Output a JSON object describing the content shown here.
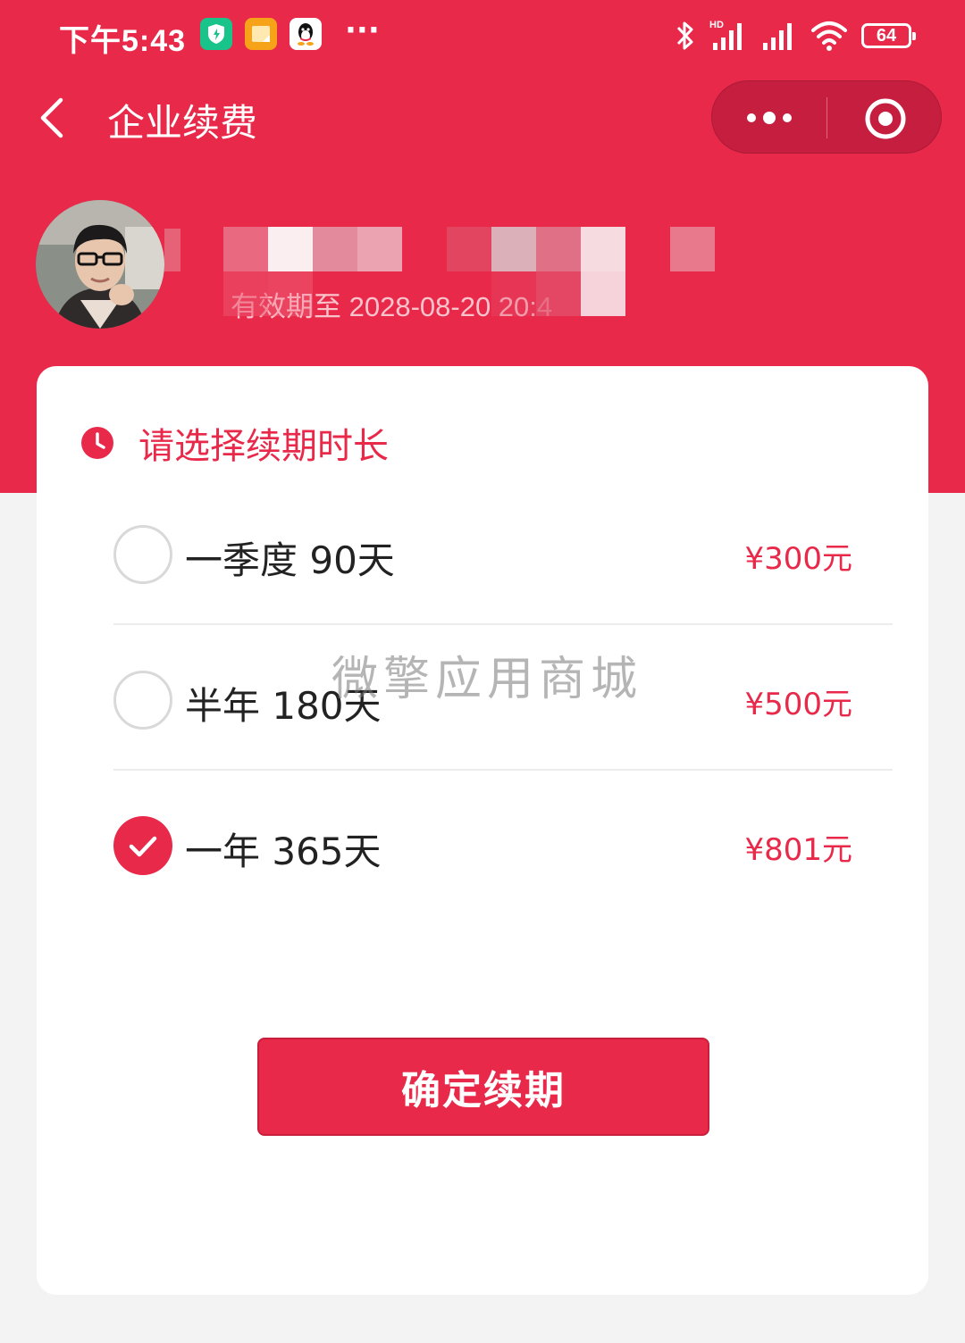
{
  "status_bar": {
    "time": "下午5:43",
    "more": "···",
    "battery": "64",
    "network_hd": "HD"
  },
  "header": {
    "title": "企业续费"
  },
  "profile": {
    "expire_text": "有效期至 2028-08-20 20:4"
  },
  "section": {
    "title": "请选择续期时长"
  },
  "options": [
    {
      "label": "一季度 90天",
      "price": "¥300元",
      "selected": false
    },
    {
      "label": "半年 180天",
      "price": "¥500元",
      "selected": false
    },
    {
      "label": "一年 365天",
      "price": "¥801元",
      "selected": true
    }
  ],
  "watermark": "微擎应用商城",
  "confirm": {
    "label": "确定续期"
  },
  "colors": {
    "brand_red": "#e8294a",
    "capsule": "#c51e3f",
    "background": "#f3f3f3"
  }
}
